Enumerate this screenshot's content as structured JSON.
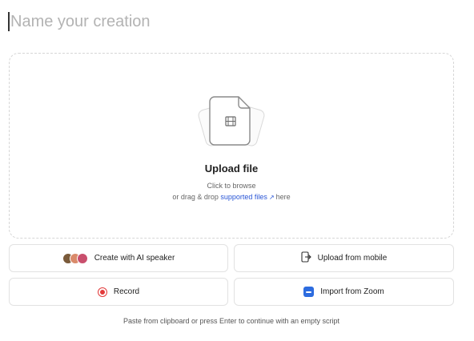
{
  "title_input": {
    "placeholder": "Name your creation",
    "value": ""
  },
  "dropzone": {
    "title": "Upload file",
    "line1": "Click to browse",
    "line2_prefix": "or drag & drop",
    "link_text": "supported files",
    "arrow": "↗",
    "line2_suffix": "here"
  },
  "buttons": {
    "ai_speaker": {
      "label": "Create with AI speaker",
      "icon": "ai-speaker-avatars-icon"
    },
    "upload_mobile": {
      "label": "Upload from mobile",
      "icon": "upload-mobile-icon"
    },
    "record": {
      "label": "Record",
      "icon": "record-icon"
    },
    "zoom": {
      "label": "Import from Zoom",
      "icon": "zoom-icon"
    }
  },
  "footer": {
    "text": "Paste from clipboard or press Enter to continue with an empty script"
  },
  "colors": {
    "link": "#2a56d6",
    "record": "#e23a3a",
    "zoom": "#2d6cdf",
    "placeholder": "#b3b3b3",
    "border": "#e2e2e2"
  }
}
